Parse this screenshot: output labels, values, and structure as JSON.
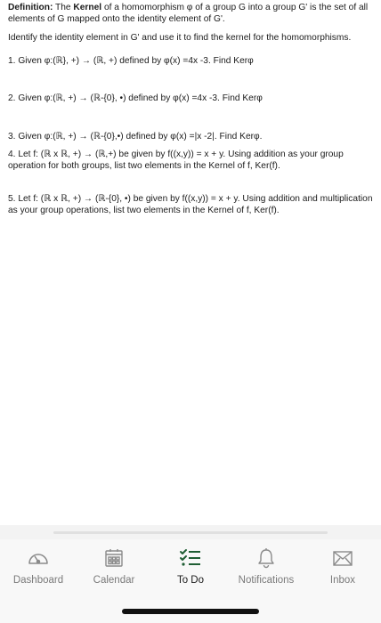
{
  "document": {
    "definition_lead": "Definition:",
    "definition_text_1": " The ",
    "definition_bold": "Kernel",
    "definition_text_2": " of a homomorphism φ of a group G into a group G' is the set of all elements of G mapped onto the identity element of G'.",
    "instruction": "Identify the identity element in G' and use it to find the kernel for the homomorphisms.",
    "questions": [
      "1.  Given φ:(ℝ}, +) → (ℝ, +) defined by φ(x) =4x -3.  Find Kerφ",
      "2.  Given φ:(ℝ, +) → (ℝ-{0}, •) defined by φ(x) =4x -3.  Find Kerφ",
      "3.  Given φ:(ℝ, +) → (ℝ-{0},•) defined by φ(x) =|x -2|.  Find Kerφ.",
      "4.  Let f: (ℝ x ℝ, +)  → (ℝ,+) be given by f((x,y)) = x + y.  Using addition as your group operation for both groups, list two elements in the Kernel of f, Ker(f).",
      "5.  Let f: (ℝ x ℝ, +)  → (ℝ-{0}, •) be given by f((x,y)) = x + y.  Using addition and multiplication as your group operations, list two elements in the Kernel  of f, Ker(f)."
    ]
  },
  "tabbar": {
    "tabs": [
      {
        "id": "dashboard",
        "label": "Dashboard",
        "icon": "gauge-icon",
        "active": false
      },
      {
        "id": "calendar",
        "label": "Calendar",
        "icon": "calendar-icon",
        "active": false
      },
      {
        "id": "todo",
        "label": "To Do",
        "icon": "checklist-icon",
        "active": true
      },
      {
        "id": "notifications",
        "label": "Notifications",
        "icon": "bell-icon",
        "active": false
      },
      {
        "id": "inbox",
        "label": "Inbox",
        "icon": "envelope-icon",
        "active": false
      }
    ]
  },
  "colors": {
    "active_icon": "#1f5e34",
    "inactive_icon": "#8a8a8a",
    "inactive_label": "#7a7a7a",
    "active_label": "#1a1a1a"
  }
}
